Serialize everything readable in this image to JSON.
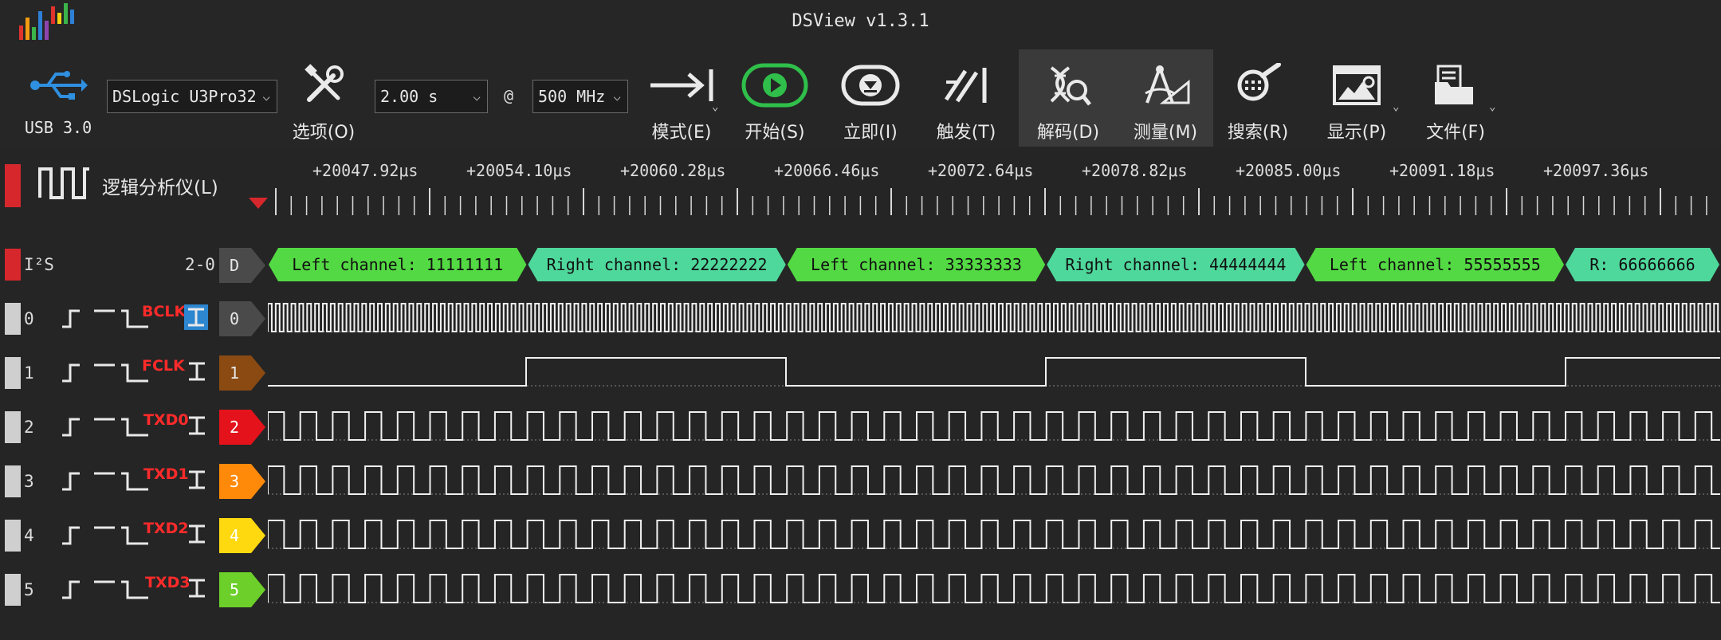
{
  "app": {
    "title": "DSView v1.3.1"
  },
  "toolbar": {
    "usb_label": "USB 3.0",
    "device_select": "DSLogic U3Pro32",
    "options_label": "选项(O)",
    "time_select": "2.00 s",
    "at_symbol": "@",
    "rate_select": "500 MHz",
    "mode_label": "模式(E)",
    "start_label": "开始(S)",
    "instant_label": "立即(I)",
    "trigger_label": "触发(T)",
    "decode_label": "解码(D)",
    "measure_label": "测量(M)",
    "search_label": "搜索(R)",
    "display_label": "显示(P)",
    "file_label": "文件(F)",
    "start_color": "#2fbf4a"
  },
  "ruler": {
    "section_label": "逻辑分析仪(L)",
    "ticks": [
      "+20047.92μs",
      "+20054.10μs",
      "+20060.28μs",
      "+20066.46μs",
      "+20072.64μs",
      "+20078.82μs",
      "+20085.00μs",
      "+20091.18μs",
      "+20097.36μs"
    ]
  },
  "decoder": {
    "name": "I²S",
    "range": "2-0",
    "tag": "D",
    "annotations": [
      "Left channel: 11111111",
      "Right channel: 22222222",
      "Left channel: 33333333",
      "Right channel: 44444444",
      "Left channel: 55555555",
      "R: 66666666"
    ],
    "left_color": "#53d943",
    "right_color": "#4fd89c"
  },
  "channels": [
    {
      "num": "0",
      "name": "BCLK",
      "tag": "0",
      "color": "#4a4a4a",
      "text_color": "#e8e8e8"
    },
    {
      "num": "1",
      "name": "FCLK",
      "tag": "1",
      "color": "#8a4a12",
      "text_color": "#e8e8e8"
    },
    {
      "num": "2",
      "name": "TXD0",
      "tag": "2",
      "color": "#e3121b",
      "text_color": "#ffffff"
    },
    {
      "num": "3",
      "name": "TXD1",
      "tag": "3",
      "color": "#ff8a0a",
      "text_color": "#ffffff"
    },
    {
      "num": "4",
      "name": "TXD2",
      "tag": "4",
      "color": "#ffd90f",
      "text_color": "#ffffff"
    },
    {
      "num": "5",
      "name": "TXD3",
      "tag": "5",
      "color": "#6ccf2a",
      "text_color": "#ffffff"
    }
  ]
}
